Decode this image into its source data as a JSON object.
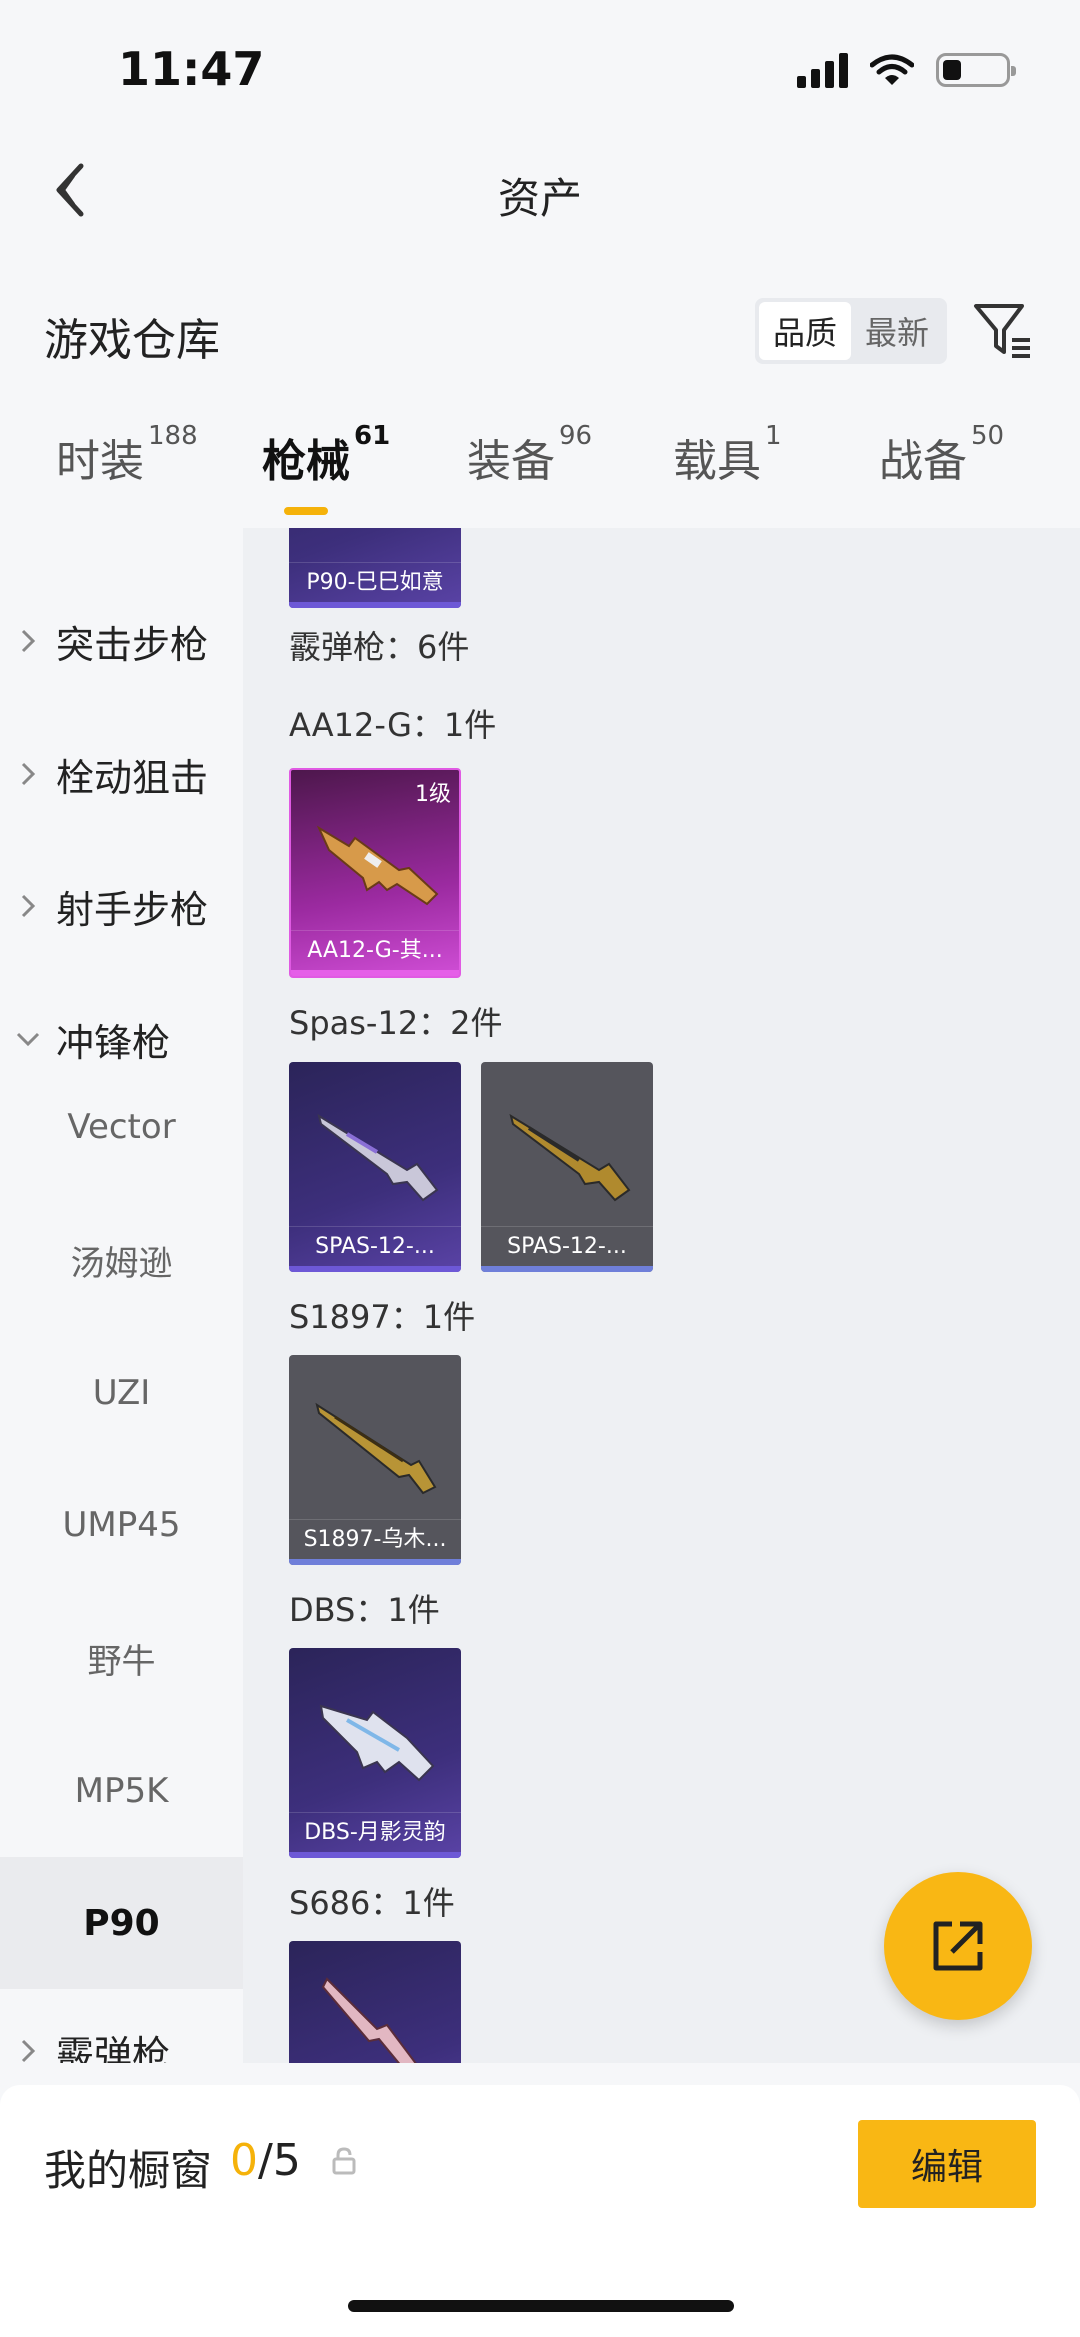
{
  "status_bar": {
    "time": "11:47"
  },
  "nav": {
    "title": "资产"
  },
  "section": {
    "title": "游戏仓库",
    "sort_options": [
      "品质",
      "最新"
    ],
    "sort_selected": "品质"
  },
  "tabs": [
    {
      "label": "时装",
      "count": "188"
    },
    {
      "label": "枪械",
      "count": "61"
    },
    {
      "label": "装备",
      "count": "96"
    },
    {
      "label": "载具",
      "count": "1"
    },
    {
      "label": "战备",
      "count": "50"
    }
  ],
  "active_tab": "枪械",
  "sidebar": {
    "categories": [
      {
        "label": "突击步枪"
      },
      {
        "label": "栓动狙击"
      },
      {
        "label": "射手步枪"
      },
      {
        "label": "冲锋枪"
      }
    ],
    "subcategories": [
      {
        "label": "Vector"
      },
      {
        "label": "汤姆逊"
      },
      {
        "label": "UZI"
      },
      {
        "label": "UMP45"
      },
      {
        "label": "野牛"
      },
      {
        "label": "MP5K"
      },
      {
        "label": "P90"
      }
    ],
    "last_category": "霰弹枪",
    "active_sub": "P90"
  },
  "content": {
    "top_card_name": "P90-巳巳如意",
    "category_summary": "霰弹枪：6件",
    "groups": [
      {
        "label": "AA12-G：1件",
        "items": [
          {
            "name": "AA12-G-其...",
            "level": "1级",
            "rarity": "pink"
          }
        ]
      },
      {
        "label": "Spas-12：2件",
        "items": [
          {
            "name": "SPAS-12-...",
            "rarity": "purple"
          },
          {
            "name": "SPAS-12-...",
            "rarity": "gray"
          }
        ]
      },
      {
        "label": "S1897：1件",
        "items": [
          {
            "name": "S1897-乌木...",
            "rarity": "gray"
          }
        ]
      },
      {
        "label": "DBS：1件",
        "items": [
          {
            "name": "DBS-月影灵韵",
            "rarity": "purple"
          }
        ]
      },
      {
        "label": "S686：1件",
        "items": [
          {
            "name": "",
            "rarity": "purple"
          }
        ]
      }
    ]
  },
  "bottom": {
    "showcase_title": "我的橱窗",
    "showcase_used": "0",
    "showcase_total": "/5",
    "edit_label": "编辑"
  },
  "colors": {
    "accent": "#f9b714",
    "pink_rarity": "#e05ae3",
    "purple_rarity": "#6d58d6"
  }
}
